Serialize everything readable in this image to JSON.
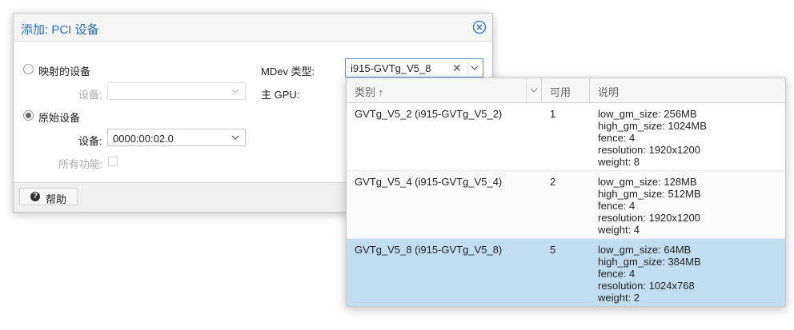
{
  "dialog": {
    "title": "添加: PCI 设备",
    "mapped_label": "映射的设备",
    "device_label": "设备:",
    "raw_label": "原始设备",
    "raw_device_label": "设备:",
    "raw_device_value": "0000:00:02.0",
    "all_functions_label": "所有功能:",
    "mdev_type_label": "MDev 类型:",
    "primary_gpu_label": "主 GPU:",
    "help_label": "帮助"
  },
  "mdev": {
    "value": "i915-GVTg_V5_8",
    "clear_glyph": "✕"
  },
  "picker": {
    "columns": {
      "category": "类别 ↑",
      "available": "可用",
      "description": "说明"
    },
    "rows": [
      {
        "category": "GVTg_V5_2 (i915-GVTg_V5_2)",
        "available": "1",
        "description": [
          "low_gm_size: 256MB",
          "high_gm_size: 1024MB",
          "fence: 4",
          "resolution: 1920x1200",
          "weight: 8"
        ],
        "selected": false
      },
      {
        "category": "GVTg_V5_4 (i915-GVTg_V5_4)",
        "available": "2",
        "description": [
          "low_gm_size: 128MB",
          "high_gm_size: 512MB",
          "fence: 4",
          "resolution: 1920x1200",
          "weight: 4"
        ],
        "selected": false
      },
      {
        "category": "GVTg_V5_8 (i915-GVTg_V5_8)",
        "available": "5",
        "description": [
          "low_gm_size: 64MB",
          "high_gm_size: 384MB",
          "fence: 4",
          "resolution: 1024x768",
          "weight: 2"
        ],
        "selected": true
      }
    ]
  },
  "colors": {
    "title": "#2a6db0",
    "selection": "#c2dcf0",
    "focus_border": "#5b95c9"
  }
}
